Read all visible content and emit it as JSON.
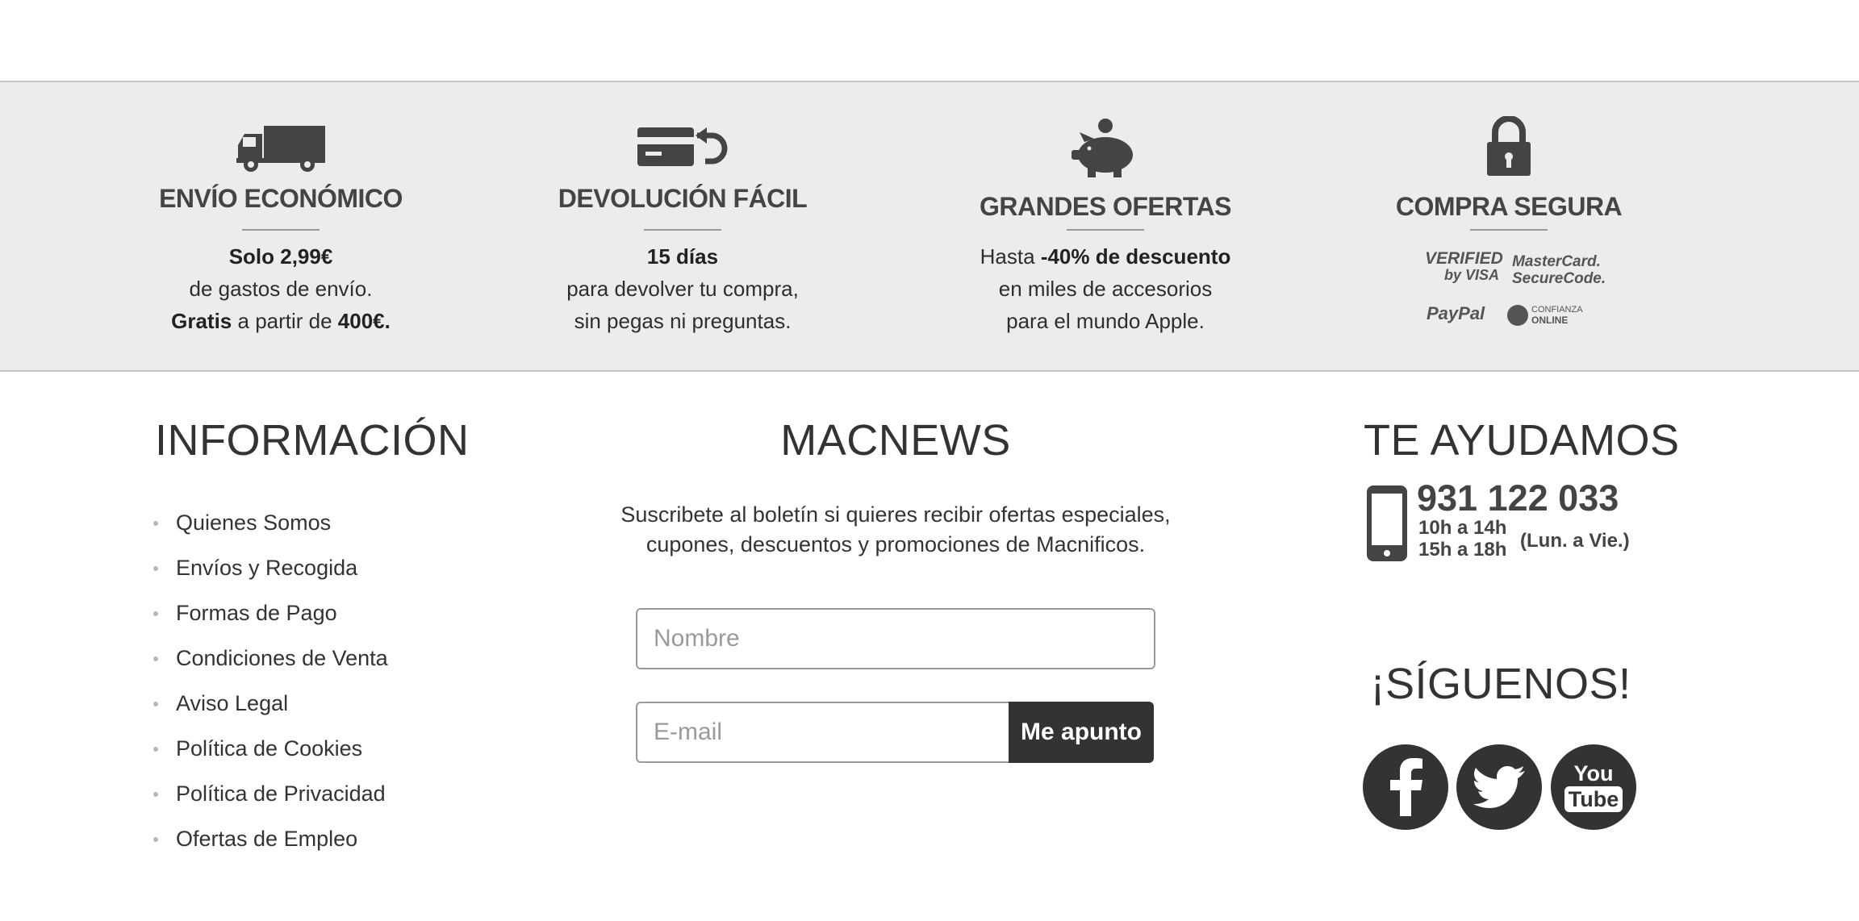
{
  "features": [
    {
      "icon": "truck-icon",
      "title": "ENVÍO ECONÓMICO",
      "line1_bold": "Solo 2,99€",
      "line2": "de gastos de envío.",
      "line3_bold_a": "Gratis",
      "line3_mid": " a partir de ",
      "line3_bold_b": "400€."
    },
    {
      "icon": "card-return-icon",
      "title": "DEVOLUCIÓN FÁCIL",
      "line1_bold": "15 días",
      "line2": "para devolver tu compra,",
      "line3": "sin pegas ni preguntas."
    },
    {
      "icon": "piggy-bank-icon",
      "title": "GRANDES OFERTAS",
      "line1_pre": "Hasta ",
      "line1_bold": "-40% de descuento",
      "line2": "en miles de accesorios",
      "line3": "para el mundo Apple."
    },
    {
      "icon": "padlock-icon",
      "title": "COMPRA SEGURA",
      "logos": {
        "verified_a": "VERIFIED",
        "verified_b": "by VISA",
        "mastercard_a": "MasterCard.",
        "mastercard_b": "SecureCode.",
        "paypal": "PayPal",
        "confianza_a": "CONFIANZA",
        "confianza_b": "ONLINE"
      }
    }
  ],
  "info": {
    "title": "INFORMACIÓN",
    "links": [
      "Quienes Somos",
      "Envíos y Recogida",
      "Formas de Pago",
      "Condiciones de Venta",
      "Aviso Legal",
      "Política de Cookies",
      "Política de Privacidad",
      "Ofertas de Empleo"
    ]
  },
  "newsletter": {
    "title": "MACNEWS",
    "desc_line1": "Suscribete al boletín si quieres recibir ofertas especiales,",
    "desc_line2": "cupones, descuentos y promociones de Macnificos.",
    "name_placeholder": "Nombre",
    "email_placeholder": "E-mail",
    "button_label": "Me apunto"
  },
  "help": {
    "title": "TE AYUDAMOS",
    "phone": "931 122 033",
    "hours1": "10h a 14h",
    "hours2": "15h a 18h",
    "days": "(Lun. a Vie.)",
    "follow_title": "¡SÍGUENOS!",
    "social": [
      "facebook-icon",
      "twitter-icon",
      "youtube-icon"
    ],
    "youtube_a": "You",
    "youtube_b": "Tube"
  },
  "colors": {
    "band_background": "#ececec",
    "text": "#333333",
    "button": "#333333",
    "social_circle": "#333333"
  }
}
